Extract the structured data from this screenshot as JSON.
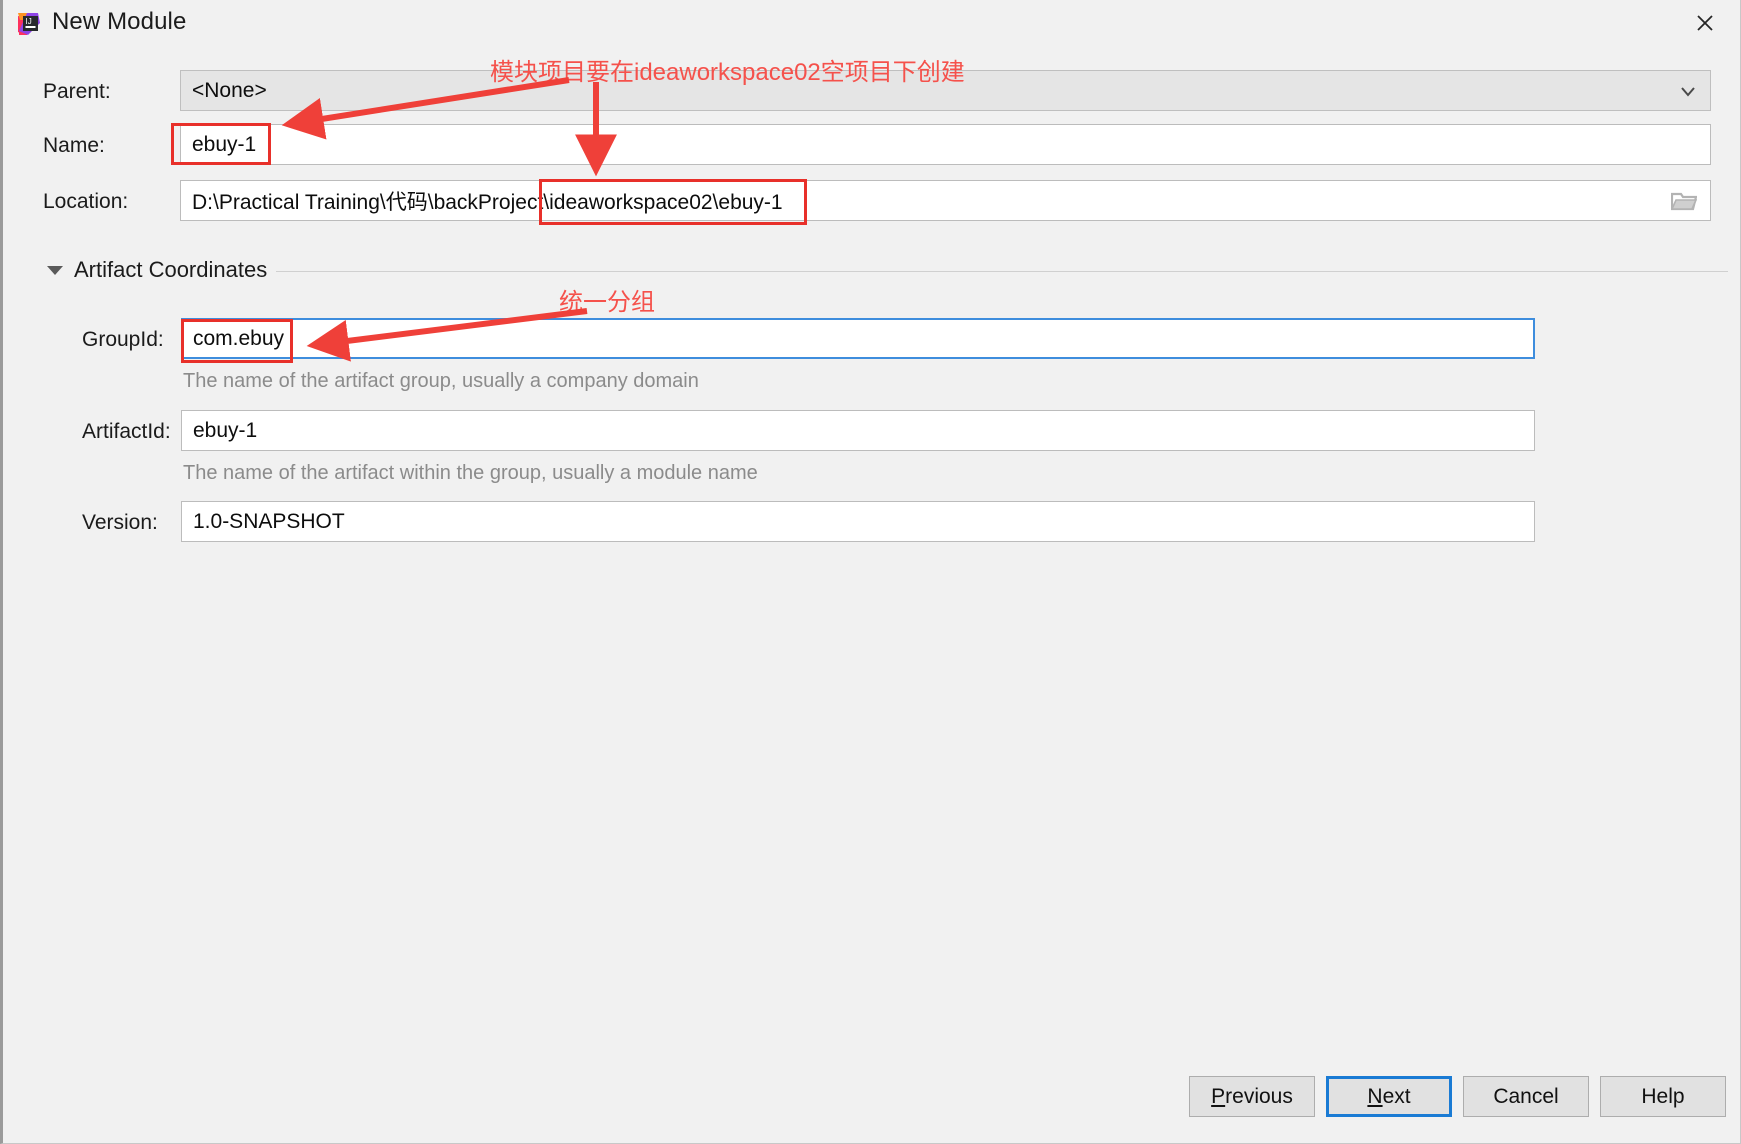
{
  "window": {
    "title": "New Module",
    "icon": "intellij-idea-icon",
    "close_icon": "close-icon"
  },
  "form": {
    "parent": {
      "label": "Parent:",
      "value": "<None>",
      "icon": "chevron-down-icon",
      "type": "combobox"
    },
    "name": {
      "label": "Name:",
      "value": "ebuy-1",
      "type": "text"
    },
    "location": {
      "label": "Location:",
      "value": "D:\\Practical Training\\代码\\backProject\\ideaworkspace02\\ebuy-1",
      "icon": "folder-open-icon",
      "type": "text-with-browse"
    }
  },
  "artifact_section": {
    "label": "Artifact Coordinates",
    "expanded": true,
    "triangle_icon": "triangle-down-icon",
    "group_id": {
      "label": "GroupId:",
      "value": "com.ebuy",
      "hint": "The name of the artifact group, usually a company domain",
      "focused": true
    },
    "artifact_id": {
      "label": "ArtifactId:",
      "value": "ebuy-1",
      "hint": "The name of the artifact within the group, usually a module name",
      "focused": false
    },
    "version": {
      "label": "Version:",
      "value": "1.0-SNAPSHOT",
      "focused": false
    }
  },
  "buttons": {
    "previous": {
      "label_prefix": "",
      "mnemonic": "P",
      "label_suffix": "revious",
      "default": false
    },
    "next": {
      "label_prefix": "",
      "mnemonic": "N",
      "label_suffix": "ext",
      "default": true
    },
    "cancel": {
      "label": "Cancel",
      "default": false
    },
    "help": {
      "label": "Help",
      "default": false
    }
  },
  "annotations": {
    "color": "#f5514b",
    "box_color": "#e8302a",
    "note_location": "模块项目要在ideaworkspace02空项目下创建",
    "note_group": "统一分组"
  }
}
